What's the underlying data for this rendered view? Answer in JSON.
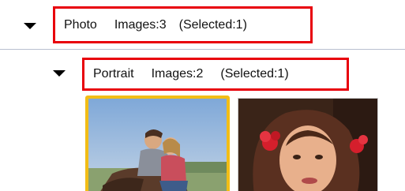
{
  "tree": {
    "photo_group": {
      "name": "Photo",
      "images_text": "Images:3",
      "selected_text": "(Selected:1)",
      "expanded": true
    },
    "portrait_group": {
      "name": "Portrait",
      "images_text": "Images:2",
      "selected_text": "(Selected:1)",
      "expanded": true
    }
  },
  "thumbnails": [
    {
      "id": "thumb-1",
      "selected": true,
      "subject": "couple-on-horse"
    },
    {
      "id": "thumb-2",
      "selected": false,
      "subject": "woman-with-red-flowers"
    }
  ],
  "colors": {
    "highlight_border": "#e8000b",
    "selected_thumb_border": "#f2bd16",
    "divider": "#b9bfd0"
  },
  "icons": {
    "expand_toggle": "triangle-down-icon"
  }
}
